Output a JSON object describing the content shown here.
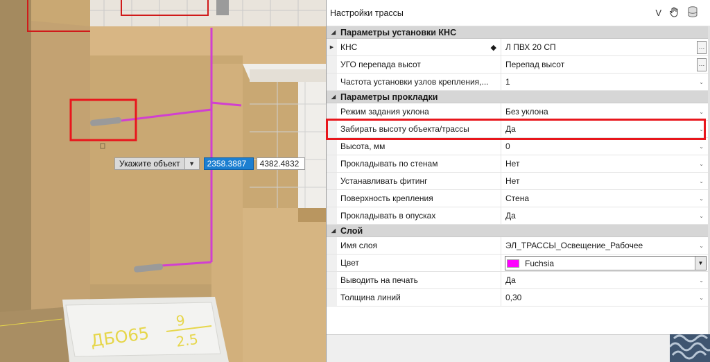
{
  "viewport": {
    "command_prompt": "Укажите объект",
    "coord_x": "2358.3887",
    "coord_y": "4382.4832",
    "block_label_line1": "ДБО65",
    "block_label_num": "9",
    "block_label_den": "2.5"
  },
  "panel": {
    "title": "Настройки трассы",
    "icons": {
      "collapse": "V",
      "hand": "hand-cursor-icon",
      "db": "database-icon"
    }
  },
  "sections": [
    {
      "title": "Параметры установки КНС",
      "rows": [
        {
          "name": "КНС",
          "value": "Л ПВХ 20 СП"
        },
        {
          "name": "УГО перепада высот",
          "value": "Перепад высот"
        },
        {
          "name": "Частота установки узлов крепления,...",
          "value": "1"
        }
      ]
    },
    {
      "title": "Параметры прокладки",
      "rows": [
        {
          "name": "Режим задания уклона",
          "value": "Без уклона"
        },
        {
          "name": "Забирать высоту объекта/трассы",
          "value": "Да"
        },
        {
          "name": "Высота, мм",
          "value": "0"
        },
        {
          "name": "Прокладывать по стенам",
          "value": "Нет"
        },
        {
          "name": "Устанавливать фитинг",
          "value": "Нет"
        },
        {
          "name": "Поверхность крепления",
          "value": "Стена"
        },
        {
          "name": "Прокладывать в опусках",
          "value": "Да"
        }
      ]
    },
    {
      "title": "Слой",
      "rows": [
        {
          "name": "Имя слоя",
          "value": "ЭЛ_ТРАССЫ_Освещение_Рабочее"
        },
        {
          "name": "Цвет",
          "value": "Fuchsia"
        },
        {
          "name": "Выводить на печать",
          "value": "Да"
        },
        {
          "name": "Толщина линий",
          "value": "0,30"
        }
      ]
    }
  ],
  "colors": {
    "accent_highlight": "#e8161c",
    "fuchsia": "#ff00ff",
    "selection_blue": "#1c7fd1"
  }
}
